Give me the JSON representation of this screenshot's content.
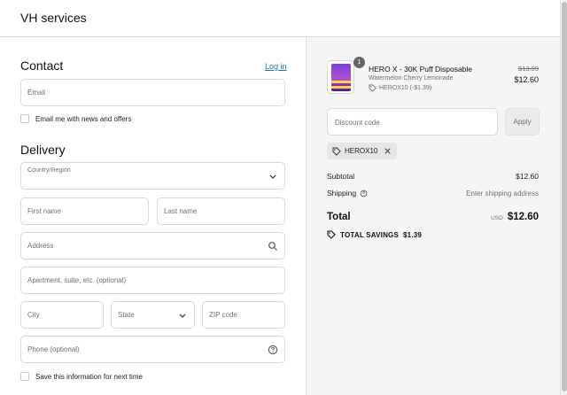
{
  "header": {
    "store_name": "VH services"
  },
  "contact": {
    "title": "Contact",
    "login_label": "Log in",
    "email_placeholder": "Email",
    "news_label": "Email me with news and offers"
  },
  "delivery": {
    "title": "Delivery",
    "country_label": "Country/Region",
    "first_name_placeholder": "First name",
    "last_name_placeholder": "Last name",
    "address_placeholder": "Address",
    "apartment_placeholder": "Apartment, suite, etc. (optional)",
    "city_placeholder": "City",
    "state_label": "State",
    "zip_placeholder": "ZIP code",
    "phone_placeholder": "Phone (optional)",
    "save_info_label": "Save this information for next time"
  },
  "summary": {
    "product": {
      "quantity": "1",
      "name": "HERO X - 30K Puff Disposable",
      "variant": "Watermelon Cherry Lemonade",
      "discount": "HEROX10 (-$1.39)",
      "original_price": "$13.99",
      "price": "$12.60"
    },
    "discount_placeholder": "Discount code",
    "apply_label": "Apply",
    "applied_code": "HEROX10",
    "subtotal_label": "Subtotal",
    "subtotal_value": "$12.60",
    "shipping_label": "Shipping",
    "shipping_value": "Enter shipping address",
    "total_label": "Total",
    "currency": "USD",
    "total_value": "$12.60",
    "savings_label": "TOTAL SAVINGS",
    "savings_value": "$1.39"
  },
  "colors": {
    "link": "#1773b0",
    "summary_bg": "#f5f5f5",
    "border": "#d9d9d9"
  },
  "icons": [
    "chevron-down-icon",
    "search-icon",
    "help-circle-icon",
    "tag-icon",
    "close-icon",
    "info-icon"
  ]
}
